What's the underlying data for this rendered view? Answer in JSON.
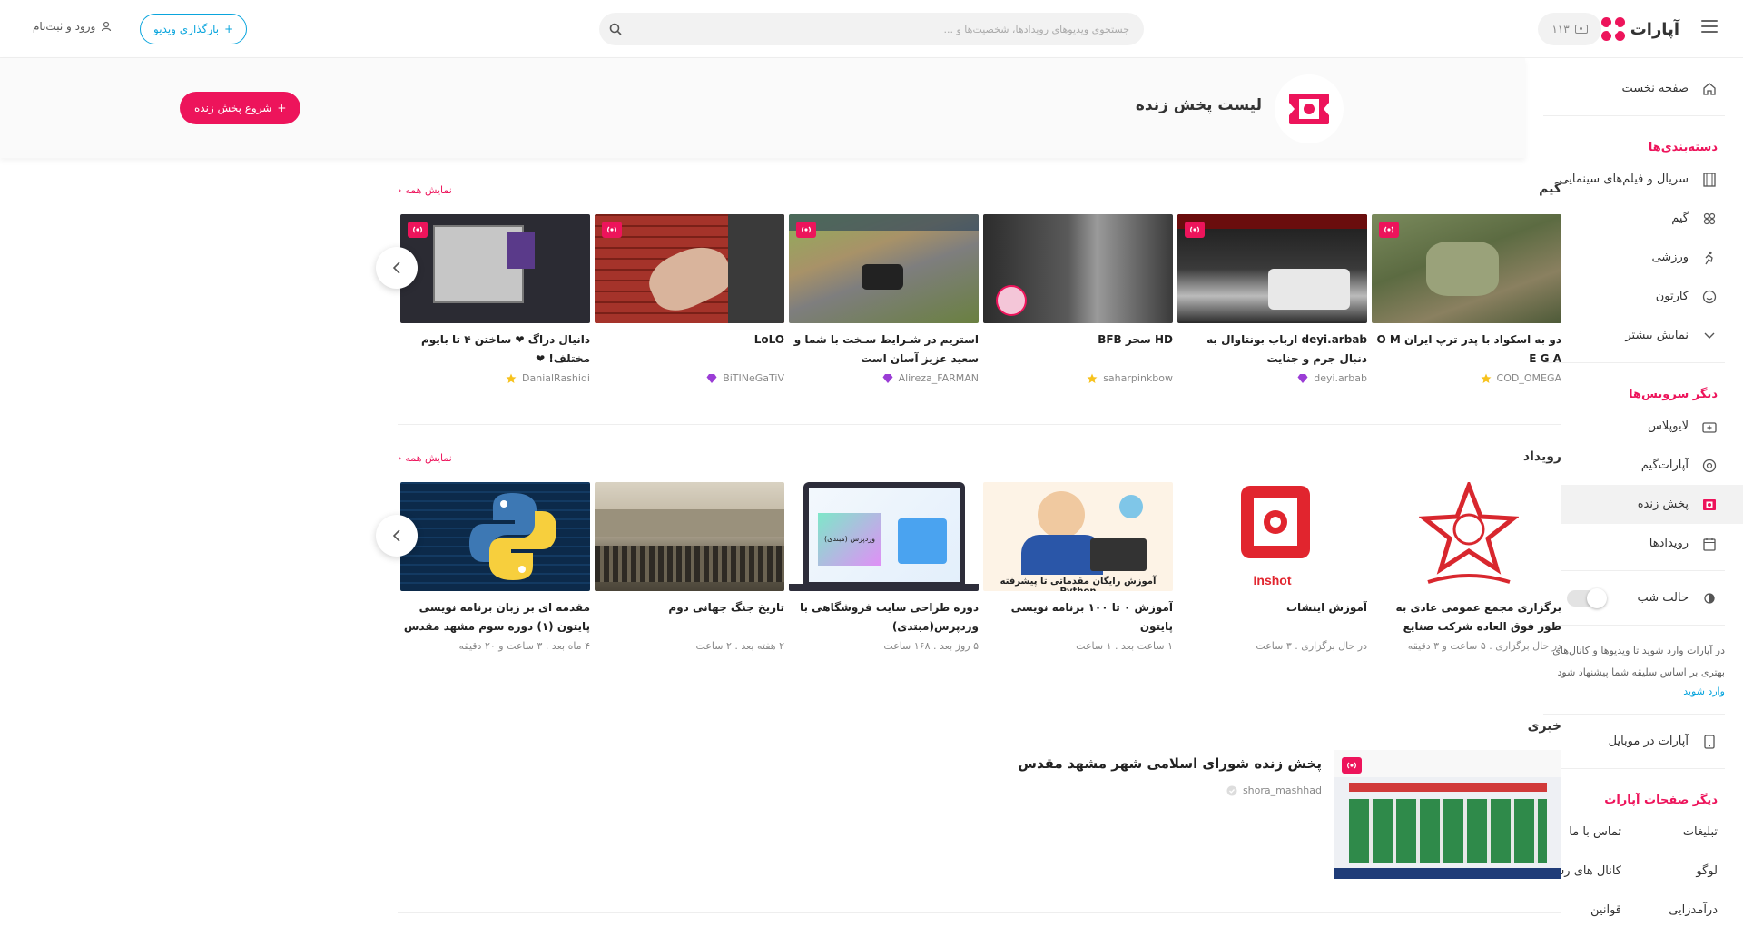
{
  "colors": {
    "accent": "#ed145b",
    "blue": "#0aa5dd"
  },
  "header": {
    "logo_text": "آپارات",
    "coins": "۱۱۳",
    "search_placeholder": "جستجوی ویدیوهای رویدادها، شخصیت‌ها و ...",
    "upload_label": "بارگذاری ویدیو",
    "login_label": "ورود و ثبت‌نام"
  },
  "sidebar": {
    "home": "صفحه نخست",
    "categories_heading": "دسته‌بندی‌ها",
    "categories": [
      "سریال و فیلم‌های سینمایی",
      "گیم",
      "ورزشی",
      "کارتون",
      "نمایش بیشتر"
    ],
    "services_heading": "دیگر سرویس‌ها",
    "services": [
      "لایوپلاس",
      "آپارات‌گیم",
      "پخش زنده",
      "رویدادها"
    ],
    "night_mode": "حالت شب",
    "note": "در آپارات وارد شوید تا ویدیوها و کانال‌های بهتری بر اساس سلیقه شما پیشنهاد شود",
    "login_link": "وارد شوید",
    "mobile": "آپارات در موبایل",
    "pages_heading": "دیگر صفحات آپارات",
    "pages": [
      "تبلیغات",
      "تماس با ما",
      "لوگو",
      "کانال های رسمی",
      "درآمدزایی",
      "قوانین"
    ]
  },
  "banner": {
    "title": "لیست پخش زنده",
    "start_button": "شروع پخش زنده"
  },
  "show_all": "نمایش همه",
  "game": {
    "title": "گیم",
    "cards": [
      {
        "title": "دو به اسکواد با پدر ترپ ایران O M E G A",
        "channel": "COD_OMEGA",
        "badge": "gold"
      },
      {
        "title": "deyi.arbab ارباب بونتاوال به دنبال جرم و جنایت",
        "channel": "deyi.arbab",
        "badge": "gem"
      },
      {
        "title": "HD سحر BFB",
        "channel": "saharpinkbow",
        "badge": "gold"
      },
      {
        "title": "استریم در شـرایط سـخت با شما و سعید عزیز آسان است",
        "channel": "Alireza_FARMAN",
        "badge": "gem"
      },
      {
        "title": "LoLO",
        "channel": "BiTINeGaTiV",
        "badge": "gem"
      },
      {
        "title": "دانیال دراگ ❤ ساختن ۴ تا بایوم مختلف! ❤",
        "channel": "DanialRashidi",
        "badge": "gold"
      }
    ]
  },
  "event": {
    "title": "رویداد",
    "cards": [
      {
        "title": "برگزاری مجمع عمومی عادی به طور فوق العاده شرکت صنایع کاشی",
        "meta": "در حال برگزاری . ۵ ساعت و ۳ دقیقه"
      },
      {
        "title": "آموزش اینشات",
        "meta": "در حال برگزاری . ۳ ساعت",
        "logo_text": "Inshot"
      },
      {
        "title": "آموزش ۰ تا ۱۰۰ برنامه نویسی پایتون",
        "meta": "۱ ساعت بعد . ۱ ساعت",
        "thumb_caption": "آموزش رایگان مقدماتی تا پیشرفته Python"
      },
      {
        "title": "دوره طراحی سایت فروشگاهی با وردپرس(مبتدی)",
        "meta": "۵ روز بعد . ۱۶۸ ساعت",
        "thumb_caption": "وردپرس (مبتدی)"
      },
      {
        "title": "تاریخ جنگ جهانی دوم",
        "meta": "۲ هفته بعد . ۲ ساعت"
      },
      {
        "title": "مقدمه ای بر زبان برنامه نویسی پایتون (۱) دوره سوم مشهد مقدس",
        "meta": "۴ ماه بعد . ۳ ساعت و ۲۰ دقیقه"
      }
    ]
  },
  "news": {
    "title": "خبری",
    "item": {
      "title": "پخش زنده شورای اسلامی شهر مشهد مقدس",
      "channel": "shora_mashhad"
    }
  }
}
